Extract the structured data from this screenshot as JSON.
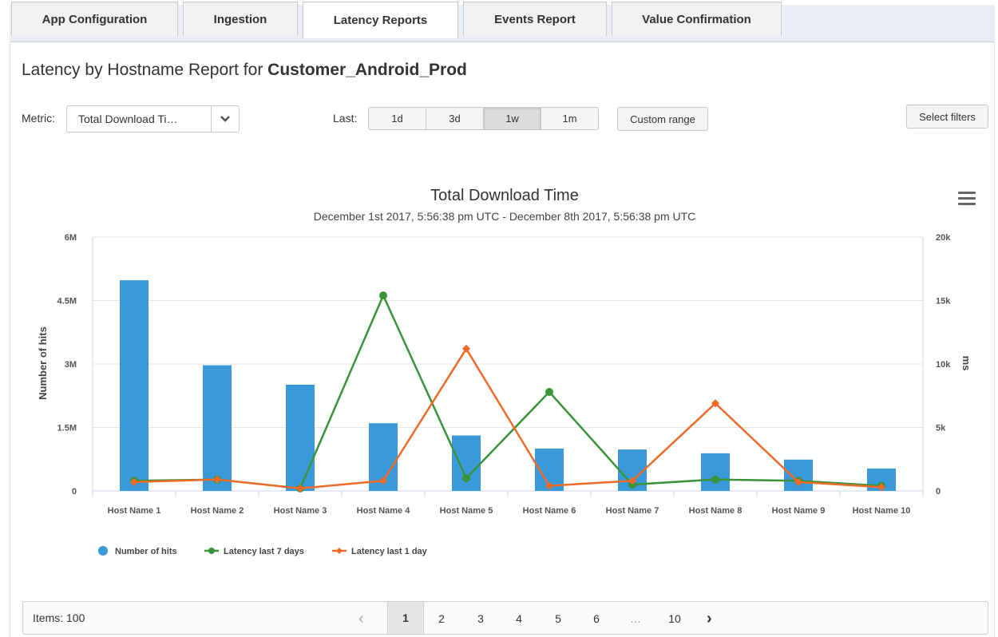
{
  "tabs": [
    {
      "label": "App Configuration"
    },
    {
      "label": "Ingestion"
    },
    {
      "label": "Latency Reports"
    },
    {
      "label": "Events Report"
    },
    {
      "label": "Value Confirmation"
    }
  ],
  "page": {
    "title_prefix": "Latency by Hostname Report for",
    "app_name": "Customer_Android_Prod"
  },
  "controls": {
    "metric_label": "Metric:",
    "metric_value": "Total Download Ti…",
    "last_label": "Last:",
    "ranges": [
      "1d",
      "3d",
      "1w",
      "1m"
    ],
    "active_range": "1w",
    "custom_range": "Custom range",
    "select_filters": "Select filters"
  },
  "chart_data": {
    "type": "bar",
    "title": "Total Download Time",
    "subtitle": "December 1st 2017, 5:56:38 pm UTC - December 8th 2017, 5:56:38 pm UTC",
    "categories": [
      "Host Name 1",
      "Host Name 2",
      "Host Name 3",
      "Host Name 4",
      "Host Name 5",
      "Host Name 6",
      "Host Name 7",
      "Host Name 8",
      "Host Name 9",
      "Host Name 10"
    ],
    "ylabel": "Number of hits",
    "ylabel_right": "ms",
    "ylim": [
      0,
      6000000
    ],
    "ylim_right": [
      0,
      20000
    ],
    "yticks": [
      "0",
      "1.5M",
      "3M",
      "4.5M",
      "6M"
    ],
    "yticks_right": [
      "0",
      "5k",
      "10k",
      "15k",
      "20k"
    ],
    "grid": true,
    "legend_position": "bottom-left",
    "series": [
      {
        "name": "Number of hits",
        "kind": "bar",
        "axis": "left",
        "color": "#3a9ad9",
        "values": [
          4980000,
          2970000,
          2510000,
          1600000,
          1310000,
          1000000,
          980000,
          890000,
          740000,
          530000
        ]
      },
      {
        "name": "Latency last 7 days",
        "kind": "line",
        "axis": "right",
        "color": "#3a923a",
        "values": [
          800,
          900,
          200,
          15400,
          1000,
          7800,
          500,
          900,
          800,
          400
        ]
      },
      {
        "name": "Latency last 1 day",
        "kind": "line",
        "axis": "right",
        "color": "#ee6b2a",
        "values": [
          700,
          900,
          200,
          800,
          11200,
          400,
          800,
          6900,
          700,
          300
        ]
      }
    ]
  },
  "pager": {
    "items_label": "Items: 100",
    "prev": "‹",
    "pages": [
      "1",
      "2",
      "3",
      "4",
      "5",
      "6",
      "…",
      "10"
    ],
    "active_page": "1",
    "next": "›"
  }
}
